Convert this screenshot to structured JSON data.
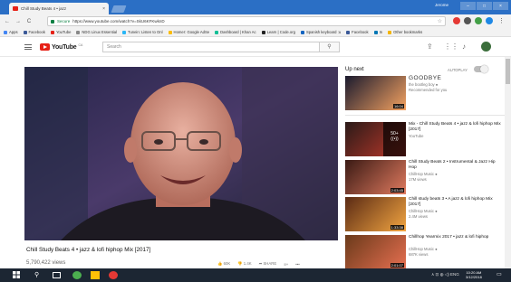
{
  "browser": {
    "tab_title": "Chill Study Beats 4 • jazz",
    "tab_close": "×",
    "user": "Jerome",
    "secure_label": "Secure",
    "url": "https://www.youtube.com/watch?v=SkU6KFKwknD",
    "bookmarks": [
      {
        "label": "Apps",
        "color": "#4285f4"
      },
      {
        "label": "Facebook",
        "color": "#3b5998"
      },
      {
        "label": "YouTube",
        "color": "#e62117"
      },
      {
        "label": "NDG Linux Essential",
        "color": "#888888"
      },
      {
        "label": "Tunein: Listen to Onl",
        "color": "#29b6f6"
      },
      {
        "label": "Homer: Google AdSe",
        "color": "#fbbc05"
      },
      {
        "label": "Dashboard | Khan Ac",
        "color": "#14bf96"
      },
      {
        "label": "Learn | Code.org",
        "color": "#222222"
      },
      {
        "label": "Spanish keyboard :u",
        "color": "#1565c0"
      },
      {
        "label": "Facebook",
        "color": "#3b5998"
      },
      {
        "label": "In",
        "color": "#0077b5"
      },
      {
        "label": "Other bookmarks",
        "color": "#f4b400"
      }
    ]
  },
  "youtube": {
    "logo_text": "YouTube",
    "logo_region": "CA",
    "search_placeholder": "Search"
  },
  "video": {
    "title": "Chill Study Beats 4 • jazz & lofi hiphop Mix [2017]",
    "views": "5,790,422 views",
    "likes": "60K",
    "dislikes": "1.4K",
    "share": "SHARE",
    "more": "•••"
  },
  "sidebar": {
    "up_next": "Up next",
    "autoplay": "AUTOPLAY",
    "items": [
      {
        "title": "GOODBYE",
        "channel": "the bootleg boy ●",
        "meta": "Recommended for you",
        "duration": "16:04",
        "thumb_color": "#1a1a2e",
        "accent": "#f4a261"
      },
      {
        "title": "Mix - Chill Study Beats 4 • jazz & lofi hiphop Mix [2017]",
        "channel": "YouTube",
        "meta": "",
        "duration": "",
        "playlist_count": "50+",
        "thumb_color": "#2a1a18",
        "accent": "#c0392b"
      },
      {
        "title": "Chill Study Beats 2 • Instrumental & Jazz Hip Hop",
        "channel": "ChillHop Music ●",
        "meta": "17M views",
        "duration": "2:03:45",
        "thumb_color": "#3a1a14",
        "accent": "#e07a5f"
      },
      {
        "title": "Chill study beats 3 • A jazz & lofi hiphop Mix [2017]",
        "channel": "ChillHop Music ●",
        "meta": "2.4M views",
        "duration": "1:33:38",
        "thumb_color": "#5a2a14",
        "accent": "#f2a541"
      },
      {
        "title": "Chillhop Yearmix 2017 • jazz & lofi hiphop",
        "channel": "ChillHop Music ●",
        "meta": "687K views",
        "duration": "2:01:07",
        "thumb_color": "#6a3a1a",
        "accent": "#e76f51"
      }
    ]
  },
  "taskbar": {
    "time": "10:20 AM",
    "date": "3/12/2018",
    "tray": "∧ ⊡ ◍ ◁) ENG"
  }
}
